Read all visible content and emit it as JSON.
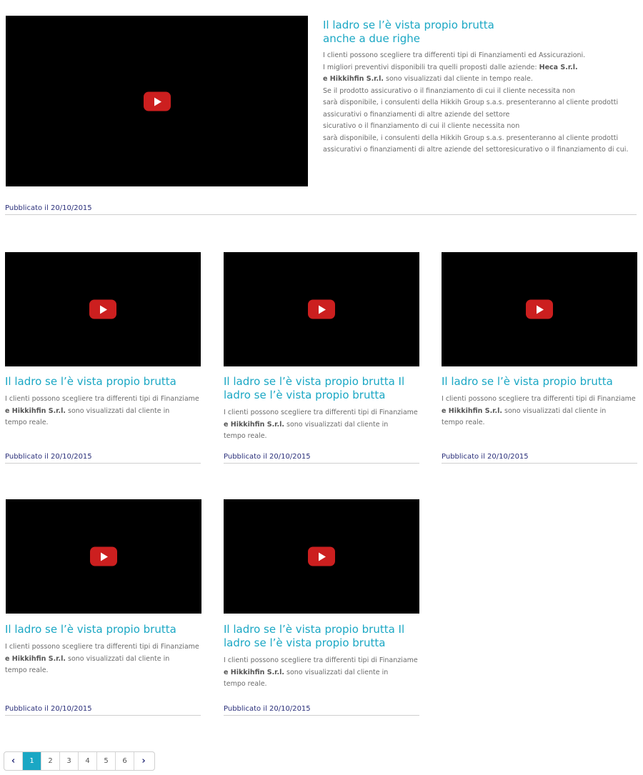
{
  "featured": {
    "title_line1": "Il ladro se l’è vista propio brutta",
    "title_line2": "anche a due righe",
    "desc_lines": [
      "I clienti possono scegliere tra differenti tipi di Finanziamenti ed Assicurazioni.",
      "I migliori preventivi disponibili tra quelli proposti dalle aziende:",
      "Heca S.r.l.",
      "e Hikkihfin S.r.l.",
      "sono visualizzati dal cliente in tempo reale.",
      "Se il prodotto assicurativo o il finanziamento di cui il cliente necessita non",
      "sarà disponibile, i consulenti della Hikkih Group s.a.s. presenteranno al cliente prodotti",
      "assicurativi o finanziamenti di altre aziende del settore",
      "sicurativo o il finanziamento di cui il cliente necessita non",
      "sarà disponibile, i consulenti della Hikkih Group s.a.s. presenteranno al cliente prodotti",
      "assicurativi o finanziamenti di altre aziende del settoresicurativo o il finanziamento di cui."
    ],
    "published": "Pubblicato il 20/10/2015"
  },
  "cards": [
    {
      "title": "Il ladro se l’è vista propio brutta",
      "desc_line1": "I clienti possono scegliere tra differenti tipi di Finanziame",
      "desc_bold": "e Hikkihfin S.r.l.",
      "desc_line2": " sono visualizzati dal cliente in",
      "desc_line3": "tempo reale.",
      "published": "Pubblicato il 20/10/2015"
    },
    {
      "title": "Il ladro se l’è vista propio brutta Il ladro se l’è vista propio brutta",
      "desc_line1": "I clienti possono scegliere tra differenti tipi di Finanziame",
      "desc_bold": "e Hikkihfin S.r.l.",
      "desc_line2": " sono visualizzati dal cliente in",
      "desc_line3": "tempo reale.",
      "published": "Pubblicato il 20/10/2015"
    },
    {
      "title": "Il ladro se l’è vista propio brutta",
      "desc_line1": "I clienti possono scegliere tra differenti tipi di Finanziame",
      "desc_bold": "e Hikkihfin S.r.l.",
      "desc_line2": " sono visualizzati dal cliente in",
      "desc_line3": "tempo reale.",
      "published": "Pubblicato il 20/10/2015"
    },
    {
      "title": "Il ladro se l’è vista propio brutta",
      "desc_line1": "I clienti possono scegliere tra differenti tipi di Finanziame",
      "desc_bold": "e Hikkihfin S.r.l.",
      "desc_line2": " sono visualizzati dal cliente in",
      "desc_line3": "tempo reale.",
      "published": "Pubblicato il 20/10/2015"
    },
    {
      "title": "Il ladro se l’è vista propio brutta Il ladro se l’è vista propio brutta",
      "desc_line1": "I clienti possono scegliere tra differenti tipi di Finanziame",
      "desc_bold": "e Hikkihfin S.r.l.",
      "desc_line2": " sono visualizzati dal cliente in",
      "desc_line3": "tempo reale.",
      "published": "Pubblicato il 20/10/2015"
    }
  ],
  "pagination": {
    "prev_icon": "chevron-left-icon",
    "next_icon": "chevron-right-icon",
    "prev_glyph": "‹",
    "next_glyph": "›",
    "pages": [
      "1",
      "2",
      "3",
      "4",
      "5",
      "6"
    ],
    "active_page": "1"
  },
  "colors": {
    "accent": "#1aa7c4",
    "link": "#2a2f7a",
    "play_button": "#cc1f1f"
  }
}
